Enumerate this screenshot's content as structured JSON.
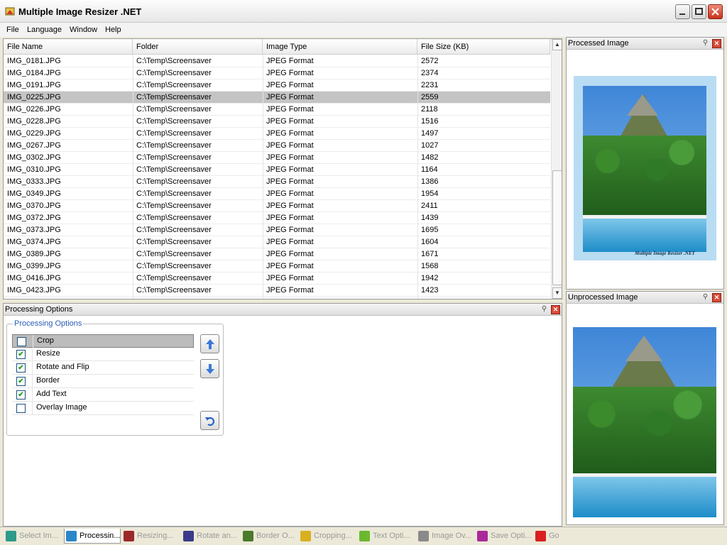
{
  "window": {
    "title": "Multiple Image Resizer .NET"
  },
  "menu": [
    "File",
    "Language",
    "Window",
    "Help"
  ],
  "file_list": {
    "columns": [
      "File Name",
      "Folder",
      "Image Type",
      "File Size (KB)"
    ],
    "selected_row": 3,
    "rows": [
      [
        "IMG_0181.JPG",
        "C:\\Temp\\Screensaver",
        "JPEG Format",
        "2572"
      ],
      [
        "IMG_0184.JPG",
        "C:\\Temp\\Screensaver",
        "JPEG Format",
        "2374"
      ],
      [
        "IMG_0191.JPG",
        "C:\\Temp\\Screensaver",
        "JPEG Format",
        "2231"
      ],
      [
        "IMG_0225.JPG",
        "C:\\Temp\\Screensaver",
        "JPEG Format",
        "2559"
      ],
      [
        "IMG_0226.JPG",
        "C:\\Temp\\Screensaver",
        "JPEG Format",
        "2118"
      ],
      [
        "IMG_0228.JPG",
        "C:\\Temp\\Screensaver",
        "JPEG Format",
        "1516"
      ],
      [
        "IMG_0229.JPG",
        "C:\\Temp\\Screensaver",
        "JPEG Format",
        "1497"
      ],
      [
        "IMG_0267.JPG",
        "C:\\Temp\\Screensaver",
        "JPEG Format",
        "1027"
      ],
      [
        "IMG_0302.JPG",
        "C:\\Temp\\Screensaver",
        "JPEG Format",
        "1482"
      ],
      [
        "IMG_0310.JPG",
        "C:\\Temp\\Screensaver",
        "JPEG Format",
        "1164"
      ],
      [
        "IMG_0333.JPG",
        "C:\\Temp\\Screensaver",
        "JPEG Format",
        "1386"
      ],
      [
        "IMG_0349.JPG",
        "C:\\Temp\\Screensaver",
        "JPEG Format",
        "1954"
      ],
      [
        "IMG_0370.JPG",
        "C:\\Temp\\Screensaver",
        "JPEG Format",
        "2411"
      ],
      [
        "IMG_0372.JPG",
        "C:\\Temp\\Screensaver",
        "JPEG Format",
        "1439"
      ],
      [
        "IMG_0373.JPG",
        "C:\\Temp\\Screensaver",
        "JPEG Format",
        "1695"
      ],
      [
        "IMG_0374.JPG",
        "C:\\Temp\\Screensaver",
        "JPEG Format",
        "1604"
      ],
      [
        "IMG_0389.JPG",
        "C:\\Temp\\Screensaver",
        "JPEG Format",
        "1671"
      ],
      [
        "IMG_0399.JPG",
        "C:\\Temp\\Screensaver",
        "JPEG Format",
        "1568"
      ],
      [
        "IMG_0416.JPG",
        "C:\\Temp\\Screensaver",
        "JPEG Format",
        "1942"
      ],
      [
        "IMG_0423.JPG",
        "C:\\Temp\\Screensaver",
        "JPEG Format",
        "1423"
      ]
    ]
  },
  "processing_panel": {
    "title": "Processing Options",
    "group_title": "Processing Options",
    "options": [
      {
        "label": "Crop",
        "checked": false,
        "selected": true
      },
      {
        "label": "Resize",
        "checked": true,
        "selected": false
      },
      {
        "label": "Rotate and Flip",
        "checked": true,
        "selected": false
      },
      {
        "label": "Border",
        "checked": true,
        "selected": false
      },
      {
        "label": "Add Text",
        "checked": true,
        "selected": false
      },
      {
        "label": "Overlay Image",
        "checked": false,
        "selected": false
      }
    ]
  },
  "processed_panel": {
    "title": "Processed Image",
    "watermark": "Multiple Image Resizer .NET"
  },
  "unprocessed_panel": {
    "title": "Unprocessed Image"
  },
  "tabs": [
    {
      "label": "Select Im...",
      "active": false,
      "color": "#2e9a8a"
    },
    {
      "label": "Processin...",
      "active": true,
      "color": "#2b86c8"
    },
    {
      "label": "Resizing...",
      "active": false,
      "color": "#9a2a2a"
    },
    {
      "label": "Rotate an...",
      "active": false,
      "color": "#3a3a8a"
    },
    {
      "label": "Border O...",
      "active": false,
      "color": "#4a7a2a"
    },
    {
      "label": "Cropping...",
      "active": false,
      "color": "#d8b020"
    },
    {
      "label": "Text Opti...",
      "active": false,
      "color": "#6ab830"
    },
    {
      "label": "Image Ov...",
      "active": false,
      "color": "#8a8a8a"
    },
    {
      "label": "Save Opti...",
      "active": false,
      "color": "#a82a9a"
    },
    {
      "label": "Go",
      "active": false,
      "color": "#d82020"
    }
  ],
  "icons": {
    "app": "app-icon",
    "pin": "pin-icon",
    "close": "close-icon",
    "move_up": "arrow-up-icon",
    "move_down": "arrow-down-icon",
    "reset": "undo-icon"
  }
}
